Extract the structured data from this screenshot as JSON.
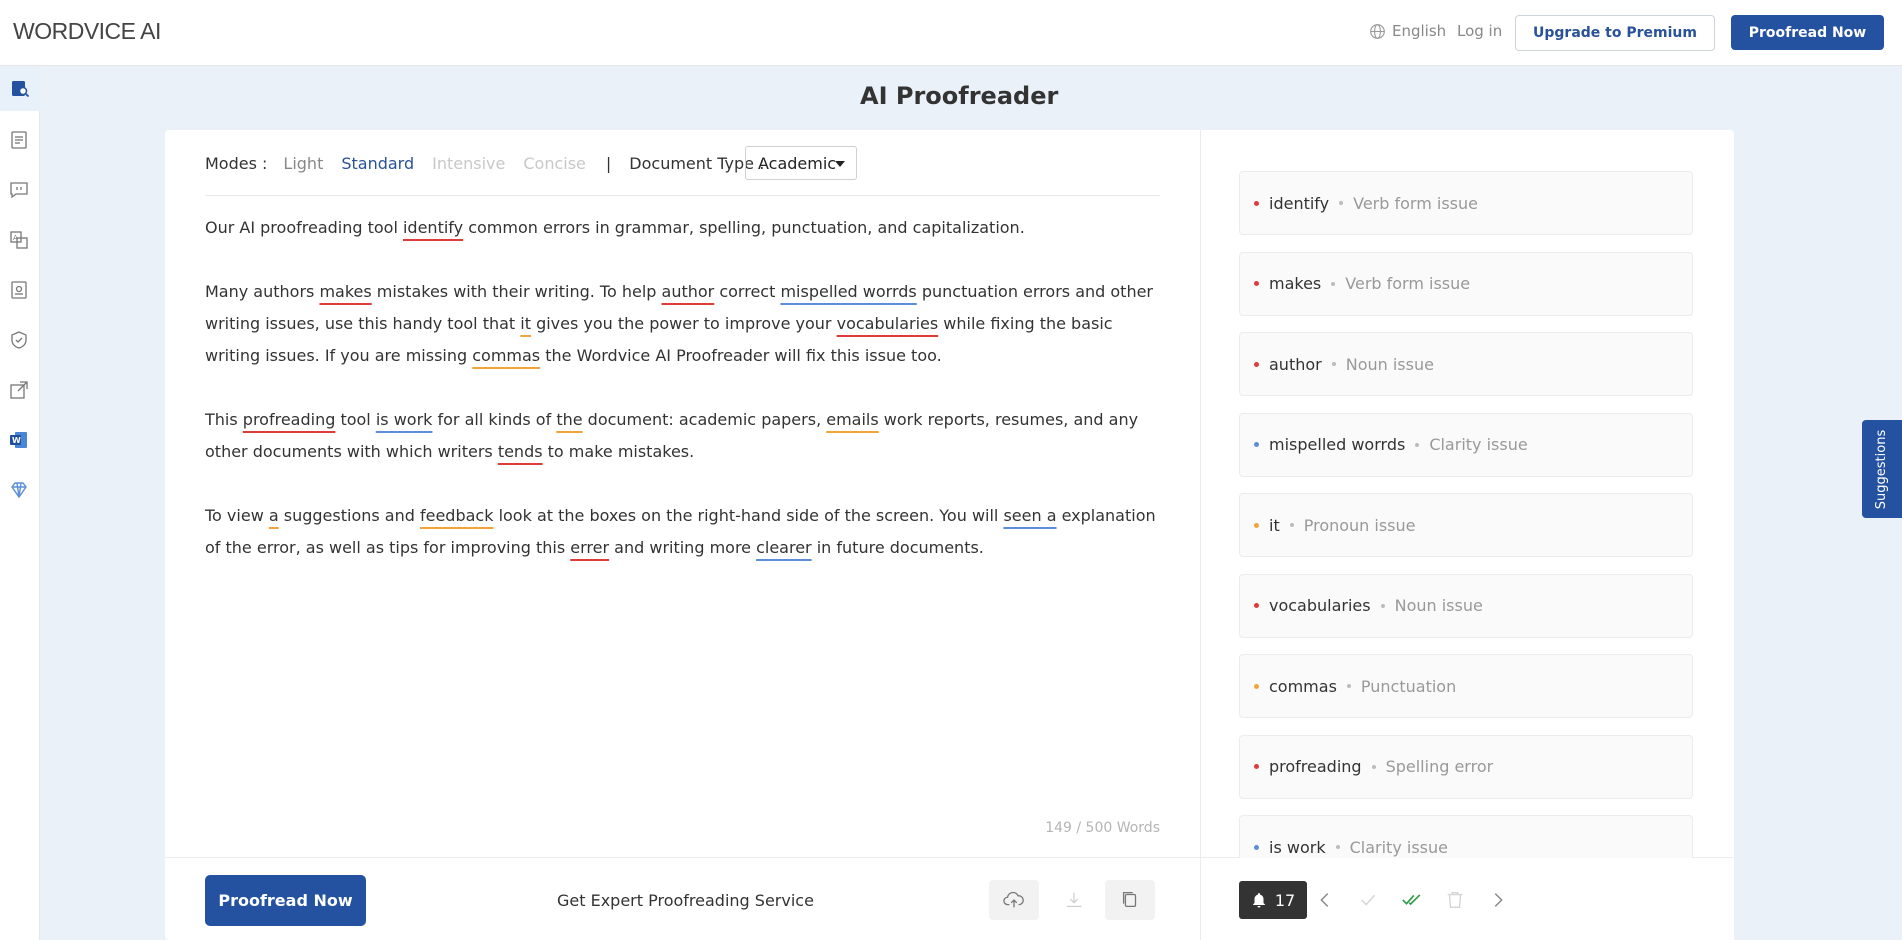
{
  "header": {
    "logo": "WORDVICE AI",
    "language": "English",
    "login": "Log in",
    "upgrade": "Upgrade to Premium",
    "proofread": "Proofread Now"
  },
  "sidebar": {
    "icons": [
      "proofreader-icon",
      "document-icon",
      "chat-quote-icon",
      "translate-icon",
      "document-check-icon",
      "shield-icon",
      "external-link-icon",
      "word-icon",
      "diamond-icon"
    ]
  },
  "page": {
    "title": "AI Proofreader"
  },
  "editor": {
    "modes_label": "Modes :",
    "modes": [
      "Light",
      "Standard",
      "Intensive",
      "Concise"
    ],
    "pipe": "|",
    "doc_type_label": "Document Type :",
    "doc_type_value": "Academic",
    "word_count": "149 / 500 Words",
    "paragraphs": [
      [
        {
          "t": "Our AI proofreading tool "
        },
        {
          "t": "identify",
          "u": "red"
        },
        {
          "t": " common errors in grammar, spelling, punctuation, and capitalization."
        }
      ],
      [
        {
          "t": "Many authors "
        },
        {
          "t": "makes",
          "u": "red"
        },
        {
          "t": " mistakes with their writing. To help "
        },
        {
          "t": "author",
          "u": "red"
        },
        {
          "t": " correct "
        },
        {
          "t": "mispelled worrds",
          "u": "blue"
        },
        {
          "t": " punctuation errors and other writing issues, use this handy tool that "
        },
        {
          "t": "it",
          "u": "orange"
        },
        {
          "t": " gives you the power to improve your "
        },
        {
          "t": "vocabularies",
          "u": "red"
        },
        {
          "t": " while fixing the basic writing issues. If you are missing "
        },
        {
          "t": "commas",
          "u": "orange"
        },
        {
          "t": " the Wordvice AI Proofreader will fix this issue too."
        }
      ],
      [
        {
          "t": "This "
        },
        {
          "t": "profreading",
          "u": "red"
        },
        {
          "t": " tool "
        },
        {
          "t": "is work",
          "u": "blue"
        },
        {
          "t": " for all kinds of "
        },
        {
          "t": "the",
          "u": "orange"
        },
        {
          "t": " document: academic papers, "
        },
        {
          "t": "emails",
          "u": "orange"
        },
        {
          "t": " work reports, resumes, and any other documents with which writers "
        },
        {
          "t": "tends",
          "u": "red"
        },
        {
          "t": " to make mistakes."
        }
      ],
      [
        {
          "t": "To view "
        },
        {
          "t": "a",
          "u": "orange"
        },
        {
          "t": " suggestions and "
        },
        {
          "t": "feedback",
          "u": "orange"
        },
        {
          "t": " look at the boxes on the right-hand side of the screen. You will "
        },
        {
          "t": "seen a",
          "u": "blue"
        },
        {
          "t": " explanation of the error, as well as tips for improving this "
        },
        {
          "t": "errer",
          "u": "red"
        },
        {
          "t": " and writing more "
        },
        {
          "t": "clearer",
          "u": "blue"
        },
        {
          "t": " in future documents."
        }
      ]
    ],
    "bottom": {
      "proofread": "Proofread Now",
      "expert": "Get Expert Proofreading Service"
    }
  },
  "suggestions": {
    "items": [
      {
        "word": "identify",
        "type": "Verb form issue",
        "color": "red"
      },
      {
        "word": "makes",
        "type": "Verb form issue",
        "color": "red"
      },
      {
        "word": "author",
        "type": "Noun issue",
        "color": "red"
      },
      {
        "word": "mispelled worrds",
        "type": "Clarity issue",
        "color": "blue"
      },
      {
        "word": "it",
        "type": "Pronoun issue",
        "color": "orange"
      },
      {
        "word": "vocabularies",
        "type": "Noun issue",
        "color": "red"
      },
      {
        "word": "commas",
        "type": "Punctuation",
        "color": "orange"
      },
      {
        "word": "profreading",
        "type": "Spelling error",
        "color": "red"
      },
      {
        "word": "is work",
        "type": "Clarity issue",
        "color": "blue"
      }
    ],
    "count": "17",
    "tab_label": "Suggestions"
  },
  "colors": {
    "brand": "#2452a0",
    "error_red": "#e03b3b",
    "clarity_blue": "#5b8ed6",
    "style_orange": "#f0a43a"
  }
}
